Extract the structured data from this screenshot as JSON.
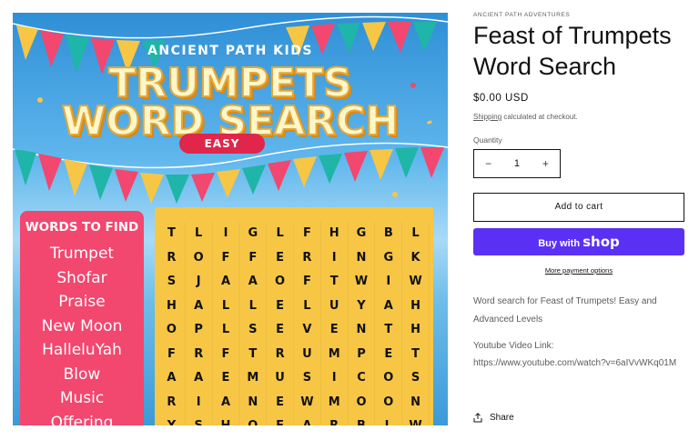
{
  "product_image": {
    "kicker": "ANCIENT PATH KIDS",
    "title_line1": "TRUMPETS",
    "title_line2": "WORD SEARCH",
    "badge": "EASY",
    "words_heading": "WORDS TO FIND",
    "words": [
      "Trumpet",
      "Shofar",
      "Praise",
      "New Moon",
      "HalleluYah",
      "Blow",
      "Music",
      "Offering"
    ],
    "grid": [
      [
        "T",
        "L",
        "I",
        "G",
        "L",
        "F",
        "H",
        "G",
        "B",
        "L"
      ],
      [
        "R",
        "O",
        "F",
        "F",
        "E",
        "R",
        "I",
        "N",
        "G",
        "K"
      ],
      [
        "S",
        "J",
        "A",
        "A",
        "O",
        "F",
        "T",
        "W",
        "I",
        "W"
      ],
      [
        "H",
        "A",
        "L",
        "L",
        "E",
        "L",
        "U",
        "Y",
        "A",
        "H"
      ],
      [
        "O",
        "P",
        "L",
        "S",
        "E",
        "V",
        "E",
        "N",
        "T",
        "H"
      ],
      [
        "F",
        "R",
        "F",
        "T",
        "R",
        "U",
        "M",
        "P",
        "E",
        "T"
      ],
      [
        "A",
        "A",
        "E",
        "M",
        "U",
        "S",
        "I",
        "C",
        "O",
        "S"
      ],
      [
        "R",
        "I",
        "A",
        "N",
        "E",
        "W",
        "M",
        "O",
        "O",
        "N"
      ],
      [
        "Y",
        "S",
        "H",
        "O",
        "F",
        "A",
        "R",
        "B",
        "L",
        "W"
      ]
    ],
    "colors": {
      "panel_pink": "#f2476f",
      "grid_yellow": "#f7c645",
      "sky_blue": "#2f8fd6"
    }
  },
  "product": {
    "vendor": "ANCIENT PATH ADVENTURES",
    "title": "Feast of Trumpets Word Search",
    "price": "$0.00 USD",
    "shipping_link": "Shipping",
    "shipping_rest": " calculated at checkout.",
    "quantity_label": "Quantity",
    "quantity_value": "1",
    "minus_symbol": "−",
    "plus_symbol": "+",
    "add_to_cart": "Add to cart",
    "buy_with": "Buy with",
    "shop_word": "shop",
    "more_payment": "More payment options",
    "description": "Word search for Feast of Trumpets! Easy and Advanced Levels",
    "youtube_label": "Youtube Video Link:",
    "youtube_url": "https://www.youtube.com/watch?v=6aIVvWKq01M",
    "share": "Share",
    "colors": {
      "shop_pay": "#5a31f4",
      "text": "#121212",
      "muted": "#5c5c5c"
    }
  }
}
